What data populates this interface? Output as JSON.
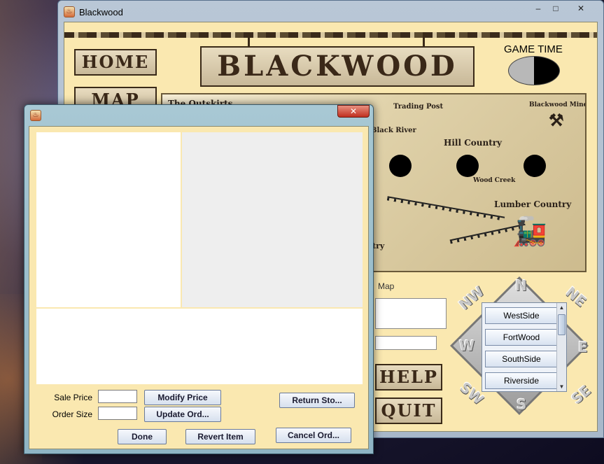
{
  "main_window": {
    "title": "Blackwood",
    "controls": {
      "minimize": "–",
      "maximize": "□",
      "close": "✕"
    },
    "nav": {
      "home": "HOME",
      "map": "MAP",
      "help": "HELP",
      "quit": "QUIT"
    },
    "banner": "BLACKWOOD",
    "game_time_label": "GAME TIME",
    "map": {
      "labels": {
        "trading_post": "Trading Post",
        "black_river": "Black River",
        "hill_country": "Hill Country",
        "wood_creek": "Wood Creek",
        "lumber_country": "Lumber Country",
        "blackwood_mine": "Blackwood Mine",
        "top_left_partial": "The Outskirts",
        "bottom_left_partial": "ntry"
      }
    },
    "map_caption": "Map",
    "compass": {
      "n": "N",
      "ne": "NE",
      "e": "E",
      "se": "SE",
      "s": "S",
      "sw": "SW",
      "w": "W",
      "nw": "NW"
    },
    "district_list": [
      "WestSide",
      "FortWood",
      "SouthSide",
      "Riverside"
    ]
  },
  "dialog": {
    "close_glyph": "✕",
    "sale_price_label": "Sale Price",
    "order_size_label": "Order Size",
    "sale_price_value": "",
    "order_size_value": "",
    "buttons": {
      "modify_price": "Modify Price",
      "update_order": "Update Ord...",
      "return_store": "Return Sto...",
      "done": "Done",
      "revert_item": "Revert Item",
      "cancel_order": "Cancel Ord..."
    }
  },
  "colors": {
    "client_bg": "#fae8b0",
    "panel_gray": "#eeeeee",
    "panel_white": "#ffffff",
    "sign_ink": "#3a2818"
  }
}
